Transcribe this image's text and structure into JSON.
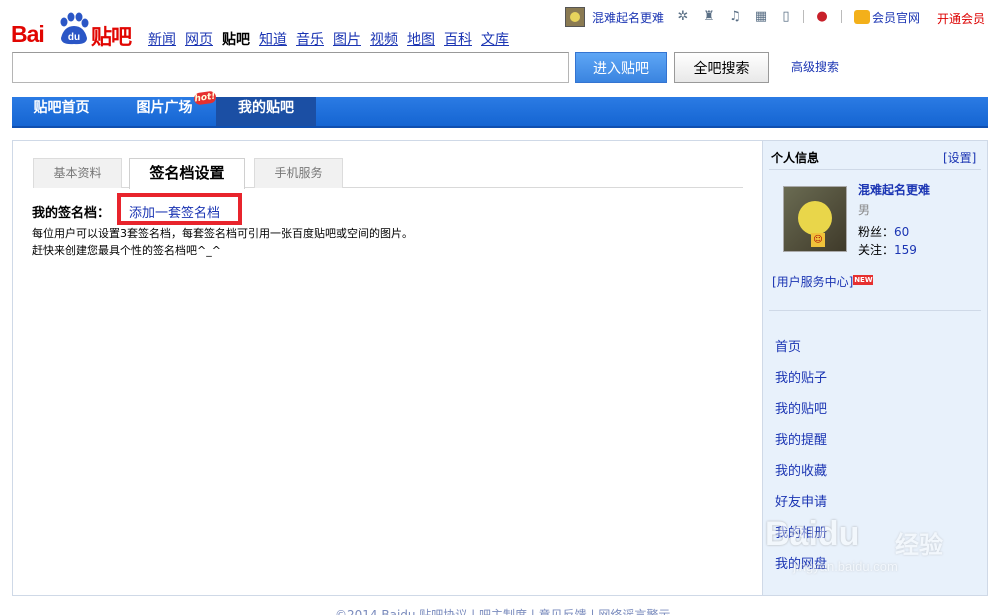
{
  "logo": {
    "bai": "Bai",
    "du": "du",
    "tieba": "贴吧"
  },
  "product_nav": [
    "新闻",
    "网页",
    "贴吧",
    "知道",
    "音乐",
    "图片",
    "视频",
    "地图",
    "百科",
    "文库"
  ],
  "product_nav_current": "贴吧",
  "user_bar": {
    "username": "混难起名更难",
    "icons": [
      "gear-icon",
      "bag-icon",
      "bell-icon",
      "store-icon",
      "tablet-icon",
      "balloon-icon"
    ],
    "vip_link": "会员官网",
    "open_vip": "开通会员"
  },
  "search": {
    "value": "",
    "enter_button": "进入贴吧",
    "search_all_button": "全吧搜索",
    "advanced": "高级搜索"
  },
  "main_tabs": [
    {
      "label": "贴吧首页",
      "active": false
    },
    {
      "label": "图片广场",
      "active": false
    },
    {
      "label": "我的贴吧",
      "active": true
    }
  ],
  "hot_badge": "hot!",
  "sub_tabs": [
    {
      "label": "基本资料",
      "active": false
    },
    {
      "label": "签名档设置",
      "active": true
    },
    {
      "label": "手机服务",
      "active": false
    }
  ],
  "signature": {
    "title": "我的签名档：",
    "add_link": "添加一套签名档",
    "desc1": "每位用户可以设置3套签名档，每套签名档可引用一张百度贴吧或空间的图片。",
    "desc2": "赶快来创建您最具个性的签名档吧^_^"
  },
  "sidebar": {
    "header": "个人信息",
    "settings": "[设置]",
    "name": "混难起名更难",
    "gender": "男",
    "fans_label": "粉丝：",
    "fans_count": "60",
    "follow_label": "关注：",
    "follow_count": "159",
    "service_center": "[用户服务中心]",
    "new_badge": "NEW",
    "menu": [
      "首页",
      "我的贴子",
      "我的贴吧",
      "我的提醒",
      "我的收藏",
      "好友申请",
      "我的相册",
      "我的网盘"
    ]
  },
  "watermark": {
    "logo": "Baidu",
    "text": "经验",
    "url": "jingyan.baidu.com"
  },
  "footer": "©2014 Baidu 贴吧协议 | 吧主制度 | 意见反馈 | 网络谣言警示"
}
